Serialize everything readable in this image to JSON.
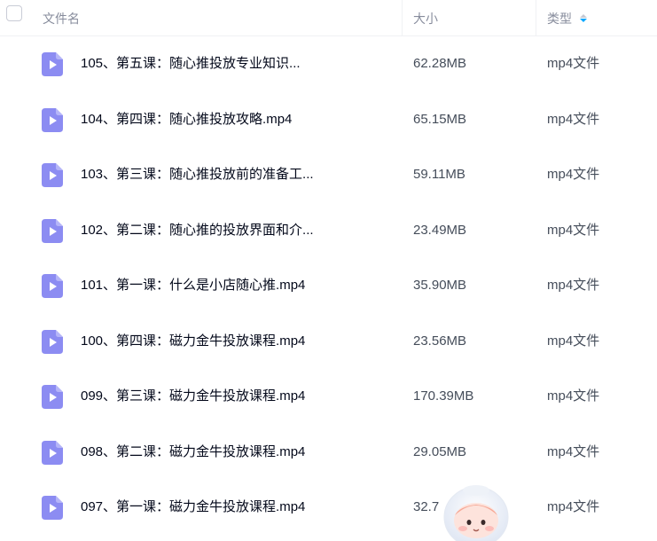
{
  "header": {
    "name_label": "文件名",
    "size_label": "大小",
    "type_label": "类型"
  },
  "files": [
    {
      "name": "105、第五课：随心推投放专业知识...",
      "size": "62.28MB",
      "type": "mp4文件"
    },
    {
      "name": "104、第四课：随心推投放攻略.mp4",
      "size": "65.15MB",
      "type": "mp4文件"
    },
    {
      "name": "103、第三课：随心推投放前的准备工...",
      "size": "59.11MB",
      "type": "mp4文件"
    },
    {
      "name": "102、第二课：随心推的投放界面和介...",
      "size": "23.49MB",
      "type": "mp4文件"
    },
    {
      "name": "101、第一课：什么是小店随心推.mp4",
      "size": "35.90MB",
      "type": "mp4文件"
    },
    {
      "name": "100、第四课：磁力金牛投放课程.mp4",
      "size": "23.56MB",
      "type": "mp4文件"
    },
    {
      "name": "099、第三课：磁力金牛投放课程.mp4",
      "size": "170.39MB",
      "type": "mp4文件"
    },
    {
      "name": "098、第二课：磁力金牛投放课程.mp4",
      "size": "29.05MB",
      "type": "mp4文件"
    },
    {
      "name": "097、第一课：磁力金牛投放课程.mp4",
      "size": "32.7",
      "type": "mp4文件"
    }
  ],
  "icons": {
    "video_file": "video-file-icon",
    "sort": "sort-icon",
    "mascot": "mascot-icon"
  },
  "colors": {
    "icon_purple": "#8c8cf2",
    "sort_active": "#06a7ff"
  }
}
